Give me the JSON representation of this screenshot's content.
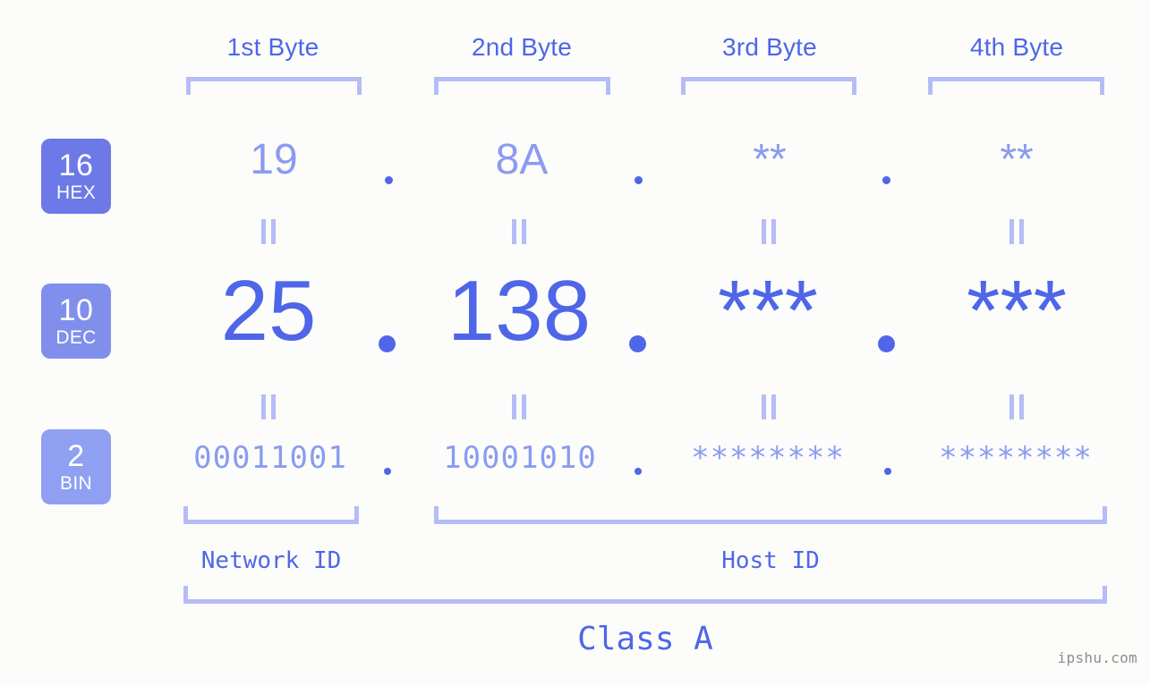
{
  "background_color": "#fcfdfa",
  "colors": {
    "accent_strong": "#4f66e8",
    "accent_light": "#8b9bf0",
    "bracket": "#b4bdf5",
    "badge_hex": "#6c79e7",
    "badge_dec": "#808feb",
    "badge_bin": "#8fa0f2",
    "watermark": "#8d8d8d"
  },
  "headers": [
    {
      "label": "1st Byte"
    },
    {
      "label": "2nd Byte"
    },
    {
      "label": "3rd Byte"
    },
    {
      "label": "4th Byte"
    }
  ],
  "bases": [
    {
      "number": "16",
      "label": "HEX"
    },
    {
      "number": "10",
      "label": "DEC"
    },
    {
      "number": "2",
      "label": "BIN"
    }
  ],
  "rows": {
    "hex": {
      "base": "16",
      "name": "HEX",
      "values": [
        "19",
        "8A",
        "**",
        "**"
      ],
      "separator": "."
    },
    "dec": {
      "base": "10",
      "name": "DEC",
      "values": [
        "25",
        "138",
        "***",
        "***"
      ],
      "separator": "."
    },
    "bin": {
      "base": "2",
      "name": "BIN",
      "values": [
        "00011001",
        "10001010",
        "********",
        "********"
      ],
      "separator": "."
    }
  },
  "equals_marks": {
    "symbol": "||",
    "count_per_row": 4,
    "rows": 2
  },
  "segments": [
    {
      "label": "Network ID",
      "bytes": 1
    },
    {
      "label": "Host ID",
      "bytes": 3
    }
  ],
  "class": {
    "label": "Class A"
  },
  "watermark": {
    "text": "ipshu.com"
  }
}
